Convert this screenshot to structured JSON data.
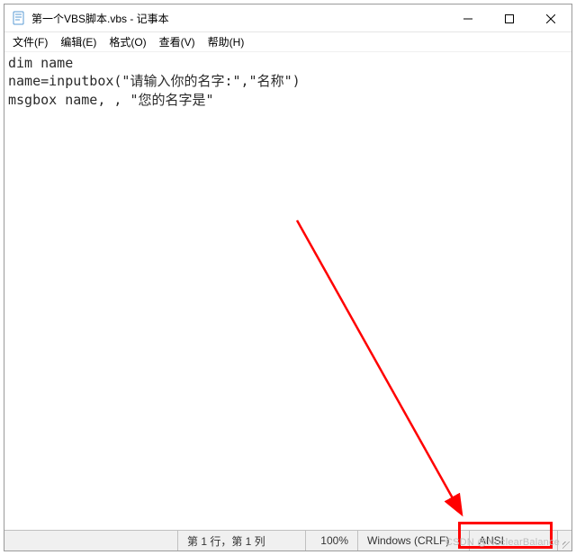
{
  "titlebar": {
    "title": "第一个VBS脚本.vbs - 记事本"
  },
  "menu": {
    "file": "文件(F)",
    "edit": "编辑(E)",
    "format": "格式(O)",
    "view": "查看(V)",
    "help": "帮助(H)"
  },
  "editor": {
    "content": "dim name\nname=inputbox(\"请输入你的名字:\",\"名称\")\nmsgbox name, , \"您的名字是\""
  },
  "statusbar": {
    "position": "第 1 行，第 1 列",
    "zoom": "100%",
    "eol": "Windows (CRLF)",
    "encoding": "ANSI"
  },
  "watermark": "CSDN @NuclearBalance",
  "annotation": {
    "highlight_target": "encoding_cell",
    "arrow_color": "#ff0000"
  }
}
